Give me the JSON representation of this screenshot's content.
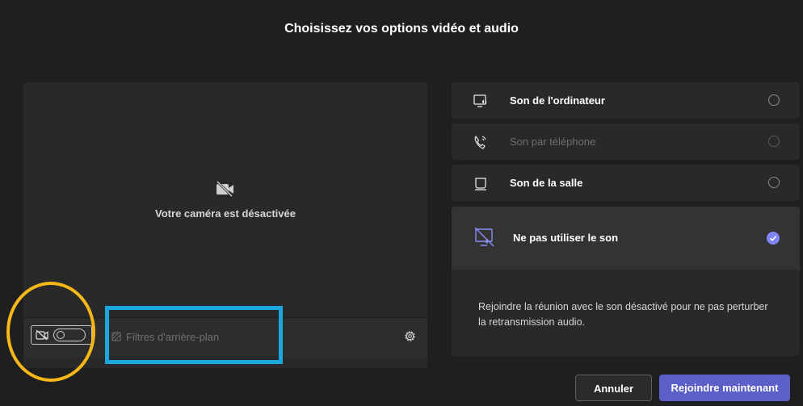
{
  "dialog": {
    "title": "Choisissez vos options vidéo et audio"
  },
  "video": {
    "camera_off_text": "Votre caméra est désactivée",
    "camera_enabled": false,
    "background_filters_label": "Filtres d'arrière-plan"
  },
  "audio": {
    "options": [
      {
        "label": "Son de l'ordinateur",
        "icon": "computer-audio-icon",
        "enabled": true,
        "selected": false
      },
      {
        "label": "Son par téléphone",
        "icon": "phone-audio-icon",
        "enabled": false,
        "selected": false
      },
      {
        "label": "Son de la salle",
        "icon": "room-audio-icon",
        "enabled": true,
        "selected": false
      },
      {
        "label": "Ne pas utiliser le son",
        "icon": "no-audio-icon",
        "enabled": true,
        "selected": true
      }
    ],
    "selected_description": "Rejoindre la réunion avec le son désactivé pour ne pas perturber la retransmission audio."
  },
  "buttons": {
    "cancel": "Annuler",
    "join": "Rejoindre maintenant"
  },
  "colors": {
    "accent": "#5b5fc7",
    "check": "#7f85f5",
    "annotation_circle": "#f8b718",
    "annotation_rect": "#1aa6e0"
  }
}
